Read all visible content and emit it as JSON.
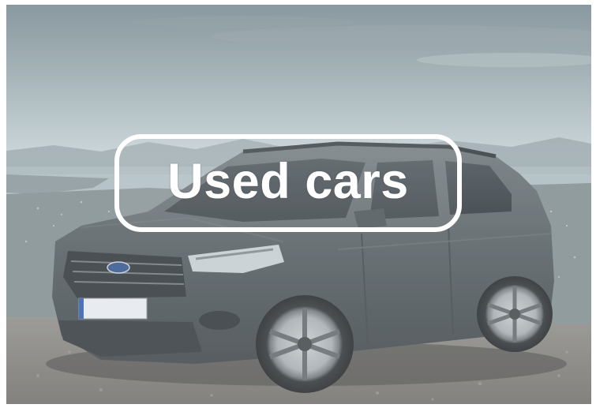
{
  "hero": {
    "label": "Used cars",
    "subject": "car-photo",
    "colors": {
      "sky_top": "#7b8c93",
      "sky_mid": "#c3cfd3",
      "car_body": "#4e5559",
      "ground": "#8e8a83",
      "label": "#ffffff"
    }
  }
}
